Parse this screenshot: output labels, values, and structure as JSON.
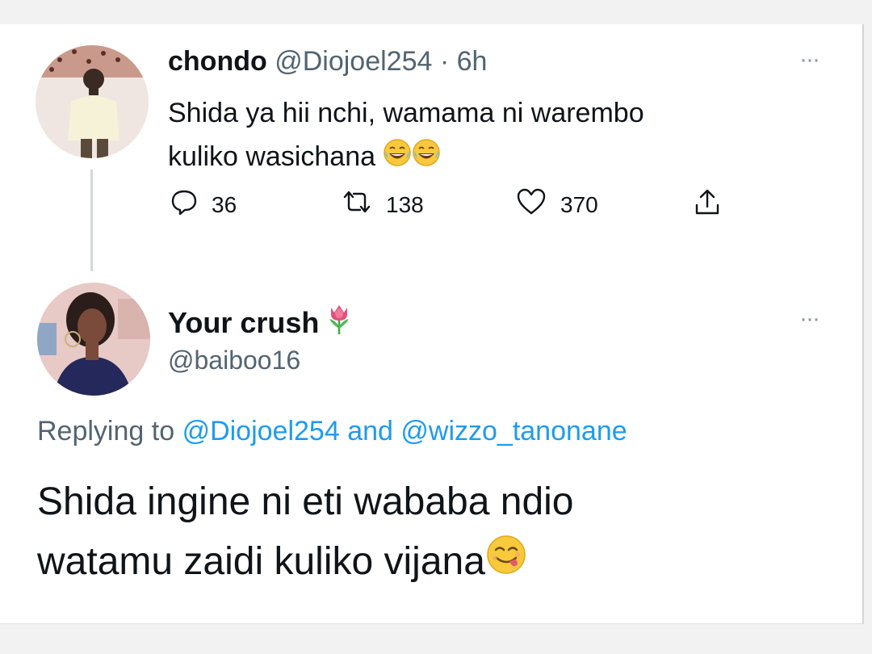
{
  "tweet": {
    "author_name": "chondo",
    "author_handle": "@Diojoel254",
    "separator": "·",
    "time": "6h",
    "text_line1": "Shida ya hii nchi, wamama ni warembo",
    "text_line2": "kuliko wasichana",
    "emoji": [
      "face-with-tears-of-joy",
      "face-with-tears-of-joy"
    ],
    "replies": "36",
    "retweets": "138",
    "likes": "370",
    "more_label": "···"
  },
  "reply": {
    "author_name": "Your crush",
    "name_emoji": "tulip",
    "author_handle": "@baiboo16",
    "more_label": "···",
    "replying_prefix": "Replying to",
    "replying_to_1": "@Diojoel254",
    "replying_and": "and",
    "replying_to_2": "@wizzo_tanonane",
    "text_line1": "Shida ingine ni eti wababa ndio",
    "text_line2": "watamu zaidi kuliko vijana",
    "emoji": "face-savoring-food"
  },
  "colors": {
    "text": "#0f1419",
    "muted": "#536471",
    "link": "#1d9bf0",
    "thread_line": "#cfd9de"
  }
}
